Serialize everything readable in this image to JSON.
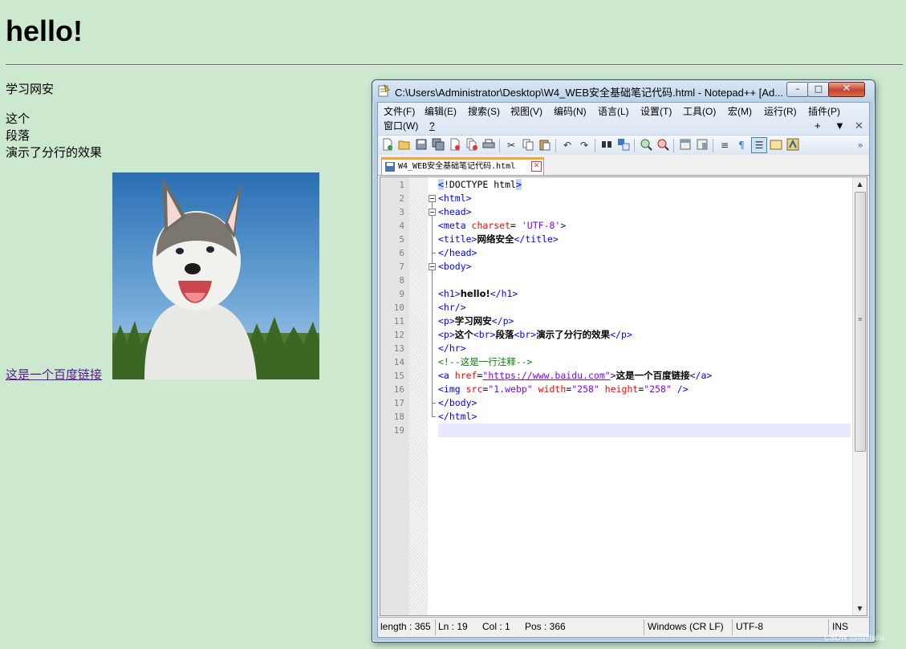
{
  "page": {
    "heading": "hello!",
    "paragraph1": "学习网安",
    "paragraph2_lines": [
      "这个",
      "段落",
      "演示了分行的效果"
    ],
    "link_text": "这是一个百度链接",
    "image_alt": "husky-puppy-photo"
  },
  "notepad": {
    "title": "C:\\Users\\Administrator\\Desktop\\W4_WEB安全基础笔记代码.html - Notepad++ [Ad...",
    "menu": [
      "文件(F)",
      "编辑(E)",
      "搜索(S)",
      "视图(V)",
      "编码(N)",
      "语言(L)",
      "设置(T)",
      "工具(O)",
      "宏(M)",
      "运行(R)",
      "插件(P)",
      "窗口(W)",
      "?"
    ],
    "menu_extras": [
      "+",
      "▼",
      "✕"
    ],
    "tab_label": "W4_WEB安全基础笔记代码.html",
    "window_buttons": {
      "minimize": "–",
      "maximize": "□",
      "close": "✕"
    },
    "line_numbers": [
      "1",
      "2",
      "3",
      "4",
      "5",
      "6",
      "7",
      "8",
      "9",
      "10",
      "11",
      "12",
      "13",
      "14",
      "15",
      "16",
      "17",
      "18",
      "19"
    ],
    "status": {
      "length": "length : 365",
      "ln": "Ln : 19",
      "col": "Col : 1",
      "pos": "Pos : 366",
      "eol": "Windows (CR LF)",
      "encoding": "UTF-8",
      "mode": "INS"
    },
    "code": {
      "l1": [
        "<",
        "!",
        "DOCTYPE html",
        ">"
      ],
      "l2": "<html>",
      "l3": "<head>",
      "l4": [
        "<meta",
        " charset",
        "=",
        " 'UTF-8'",
        ">"
      ],
      "l5": [
        "<title>",
        "网络安全",
        "</title>"
      ],
      "l6": "</head>",
      "l7": "<body>",
      "l9": [
        "<h1>",
        "hello!",
        "</h1>"
      ],
      "l10": "<hr/>",
      "l11": [
        "<p>",
        "学习网安",
        "</p>"
      ],
      "l12": [
        "<p>",
        "这个",
        "<br>",
        "段落",
        "<br>",
        "演示了分行的效果",
        "</p>"
      ],
      "l13": "</hr>",
      "l14": "<!--这是一行注释-->",
      "l15": [
        "<a",
        " href",
        "=",
        "\"https://www.baidu.com\"",
        ">",
        "这是一个百度链接",
        "</a>"
      ],
      "l16": [
        "<img",
        " src",
        "=",
        "\"1.webp\"",
        " width",
        "=",
        "\"258\"",
        " height",
        "=",
        "\"258\"",
        " />"
      ],
      "l17": "</body>",
      "l18": "</html>"
    }
  },
  "watermark": "CSDN @晓Hulu"
}
